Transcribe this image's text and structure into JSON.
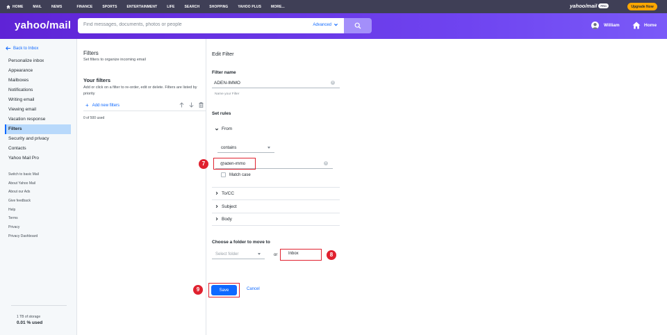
{
  "topnav": {
    "items": [
      "HOME",
      "MAIL",
      "NEWS",
      "FINANCE",
      "SPORTS",
      "ENTERTAINMENT",
      "LIFE",
      "SEARCH",
      "SHOPPING",
      "YAHOO PLUS",
      "MORE..."
    ],
    "brand": "yahoo/mail",
    "brand_badge": "PRO",
    "upgrade": "Upgrade Now"
  },
  "header": {
    "logo": "yahoo/mail",
    "search_placeholder": "Find messages, documents, photos or people",
    "advanced": "Advanced",
    "user_name": "William",
    "home": "Home"
  },
  "sidebar": {
    "back": "Back to Inbox",
    "items": [
      "Personalize inbox",
      "Appearance",
      "Mailboxes",
      "Notifications",
      "Writing email",
      "Viewing email",
      "Vacation response",
      "Filters",
      "Security and privacy",
      "Contacts",
      "Yahoo Mail Pro"
    ],
    "active_index": 7,
    "links": [
      "Switch to basic Mail",
      "About Yahoo Mail",
      "About our Ads",
      "Give feedback",
      "Help",
      "Terms",
      "Privacy",
      "Privacy Dashboard"
    ],
    "storage_total": "1 TB of storage",
    "storage_used": "0.01 % used"
  },
  "filters": {
    "title": "Filters",
    "subtitle": "Set filters to organize incoming email",
    "your_filters": "Your filters",
    "description": "Add or click on a filter to re-order, edit or delete. Filters are listed by priority",
    "add_new": "Add new filters",
    "count": "0 of 500 used"
  },
  "edit": {
    "title": "Edit Filter",
    "filter_name_label": "Filter name",
    "filter_name_value": "ADEN-IMMO",
    "filter_name_helper": "Name your Filter",
    "set_rules": "Set rules",
    "from": "From",
    "condition": "contains",
    "from_value": "@aden-immo",
    "match_case": "Match case",
    "to_cc": "To/CC",
    "subject": "Subject",
    "body": "Body",
    "folder_label": "Choose a folder to move to",
    "select_folder_placeholder": "Select folder",
    "or": "or",
    "new_folder_value": "Inbox",
    "save": "Save",
    "cancel": "Cancel"
  },
  "annotations": {
    "badge_7": "7",
    "badge_8": "8",
    "badge_9": "9",
    "color": "#e0212f"
  }
}
